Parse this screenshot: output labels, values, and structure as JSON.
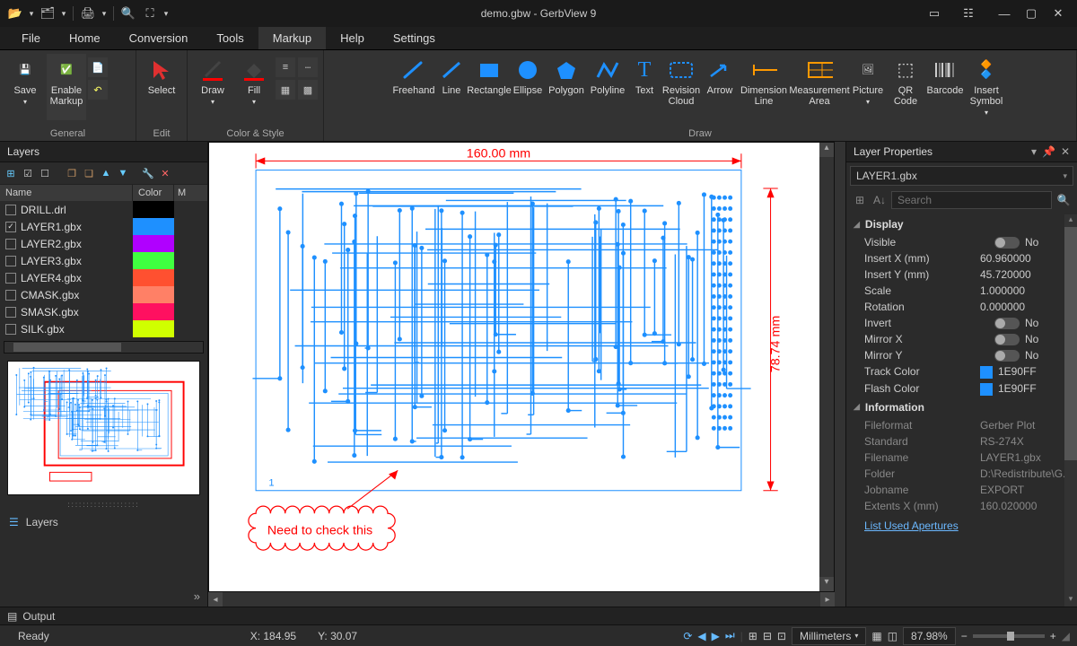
{
  "title": "demo.gbw - GerbView 9",
  "menu": [
    "File",
    "Home",
    "Conversion",
    "Tools",
    "Markup",
    "Help",
    "Settings"
  ],
  "activeMenu": "Markup",
  "ribbon": {
    "groups": {
      "general": "General",
      "edit": "Edit",
      "color": "Color & Style",
      "draw": "Draw"
    },
    "save": "Save",
    "enableMarkup": "Enable Markup",
    "select": "Select",
    "drawBtn": "Draw",
    "fill": "Fill",
    "freehand": "Freehand",
    "line": "Line",
    "rectangle": "Rectangle",
    "ellipse": "Ellipse",
    "polygon": "Polygon",
    "polyline": "Polyline",
    "text": "Text",
    "revisionCloud": "Revision Cloud",
    "arrow": "Arrow",
    "dimensionLine": "Dimension Line",
    "measurementArea": "Measurement Area",
    "picture": "Picture",
    "qrCode": "QR Code",
    "barcode": "Barcode",
    "insertSymbol": "Insert Symbol"
  },
  "layersPanel": {
    "title": "Layers",
    "headers": {
      "name": "Name",
      "color": "Color",
      "m": "M"
    },
    "rows": [
      {
        "name": "DRILL.drl",
        "color": "#000000",
        "checked": false
      },
      {
        "name": "LAYER1.gbx",
        "color": "#1E90FF",
        "checked": true
      },
      {
        "name": "LAYER2.gbx",
        "color": "#b000ff",
        "checked": false
      },
      {
        "name": "LAYER3.gbx",
        "color": "#40ff40",
        "checked": false
      },
      {
        "name": "LAYER4.gbx",
        "color": "#ff5030",
        "checked": false
      },
      {
        "name": "CMASK.gbx",
        "color": "#ff8066",
        "checked": false
      },
      {
        "name": "SMASK.gbx",
        "color": "#ff1060",
        "checked": false
      },
      {
        "name": "SILK.gbx",
        "color": "#d0ff00",
        "checked": false
      }
    ],
    "accordion": "Layers"
  },
  "canvas": {
    "dimWidth": "160.00 mm",
    "dimHeight": "78.74 mm",
    "calloutText": "Need to check this",
    "cornerNum": "1"
  },
  "layerProps": {
    "title": "Layer Properties",
    "combo": "LAYER1.gbx",
    "searchPlaceholder": "Search",
    "sections": {
      "display": "Display",
      "information": "Information"
    },
    "display": {
      "visible": {
        "k": "Visible",
        "v": "No"
      },
      "insertX": {
        "k": "Insert X (mm)",
        "v": "60.960000"
      },
      "insertY": {
        "k": "Insert Y (mm)",
        "v": "45.720000"
      },
      "scale": {
        "k": "Scale",
        "v": "1.000000"
      },
      "rotation": {
        "k": "Rotation",
        "v": "0.000000"
      },
      "invert": {
        "k": "Invert",
        "v": "No"
      },
      "mirrorX": {
        "k": "Mirror X",
        "v": "No"
      },
      "mirrorY": {
        "k": "Mirror Y",
        "v": "No"
      },
      "trackColor": {
        "k": "Track Color",
        "v": "1E90FF"
      },
      "flashColor": {
        "k": "Flash Color",
        "v": "1E90FF"
      }
    },
    "info": {
      "fileformat": {
        "k": "Fileformat",
        "v": "Gerber Plot"
      },
      "standard": {
        "k": "Standard",
        "v": "RS-274X"
      },
      "filename": {
        "k": "Filename",
        "v": "LAYER1.gbx"
      },
      "folder": {
        "k": "Folder",
        "v": "D:\\Redistribute\\G..."
      },
      "jobname": {
        "k": "Jobname",
        "v": "EXPORT"
      },
      "extentsX": {
        "k": "Extents X (mm)",
        "v": "160.020000"
      }
    },
    "link": "List Used Apertures"
  },
  "output": "Output",
  "status": {
    "ready": "Ready",
    "x": "X: 184.95",
    "y": "Y: 30.07",
    "units": "Millimeters",
    "zoom": "87.98%"
  }
}
